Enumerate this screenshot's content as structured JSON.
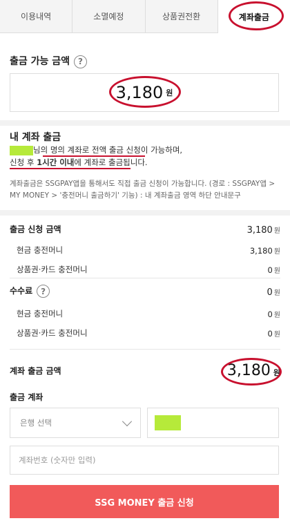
{
  "tabs": [
    {
      "label": "이용내역"
    },
    {
      "label": "소멸예정"
    },
    {
      "label": "상품권전환"
    },
    {
      "label": "계좌출금"
    }
  ],
  "available": {
    "title": "출금 가능 금액",
    "help": "?",
    "amount": "3,180",
    "unit": "원"
  },
  "withdraw": {
    "title": "내 계좌 출금",
    "line1_a": "님의 ",
    "line1_b": "명의 계좌로 전액 출금 신청이 가능",
    "line1_c": "하며,",
    "line2_a": "신청 후 ",
    "line2_b": "1시간 이내",
    "line2_c": "에 계좌로 출금됩니다.",
    "info": "계좌출금은 SSGPAY앱을 통해서도 직접 출금 신청이 가능합니다. (경로 : SSGPAY앱 > MY MONEY > '충전머니 출금하기' 기능) : 내 계좌출금 영역 하단 안내문구"
  },
  "breakdown": {
    "request_label": "출금 신청 금액",
    "request_value": "3,180",
    "cash1_label": "현금 충전머니",
    "cash1_value": "3,180",
    "card1_label": "상품권·카드 충전머니",
    "card1_value": "0",
    "fee_label": "수수료",
    "fee_value": "0",
    "cash2_label": "현금 충전머니",
    "cash2_value": "0",
    "card2_label": "상품권·카드 충전머니",
    "card2_value": "0",
    "unit": "원"
  },
  "final": {
    "label": "계좌 출금 금액",
    "amount": "3,180",
    "unit": "원"
  },
  "account": {
    "title": "출금 계좌",
    "bank_select": "은행 선택",
    "account_placeholder": "계좌번호 (숫자만 입력)"
  },
  "submit_label": "SSG MONEY 출금 신청",
  "colors": {
    "accent": "#f15a5a",
    "annotation": "#c8102e",
    "highlight": "#b6ea3a"
  }
}
